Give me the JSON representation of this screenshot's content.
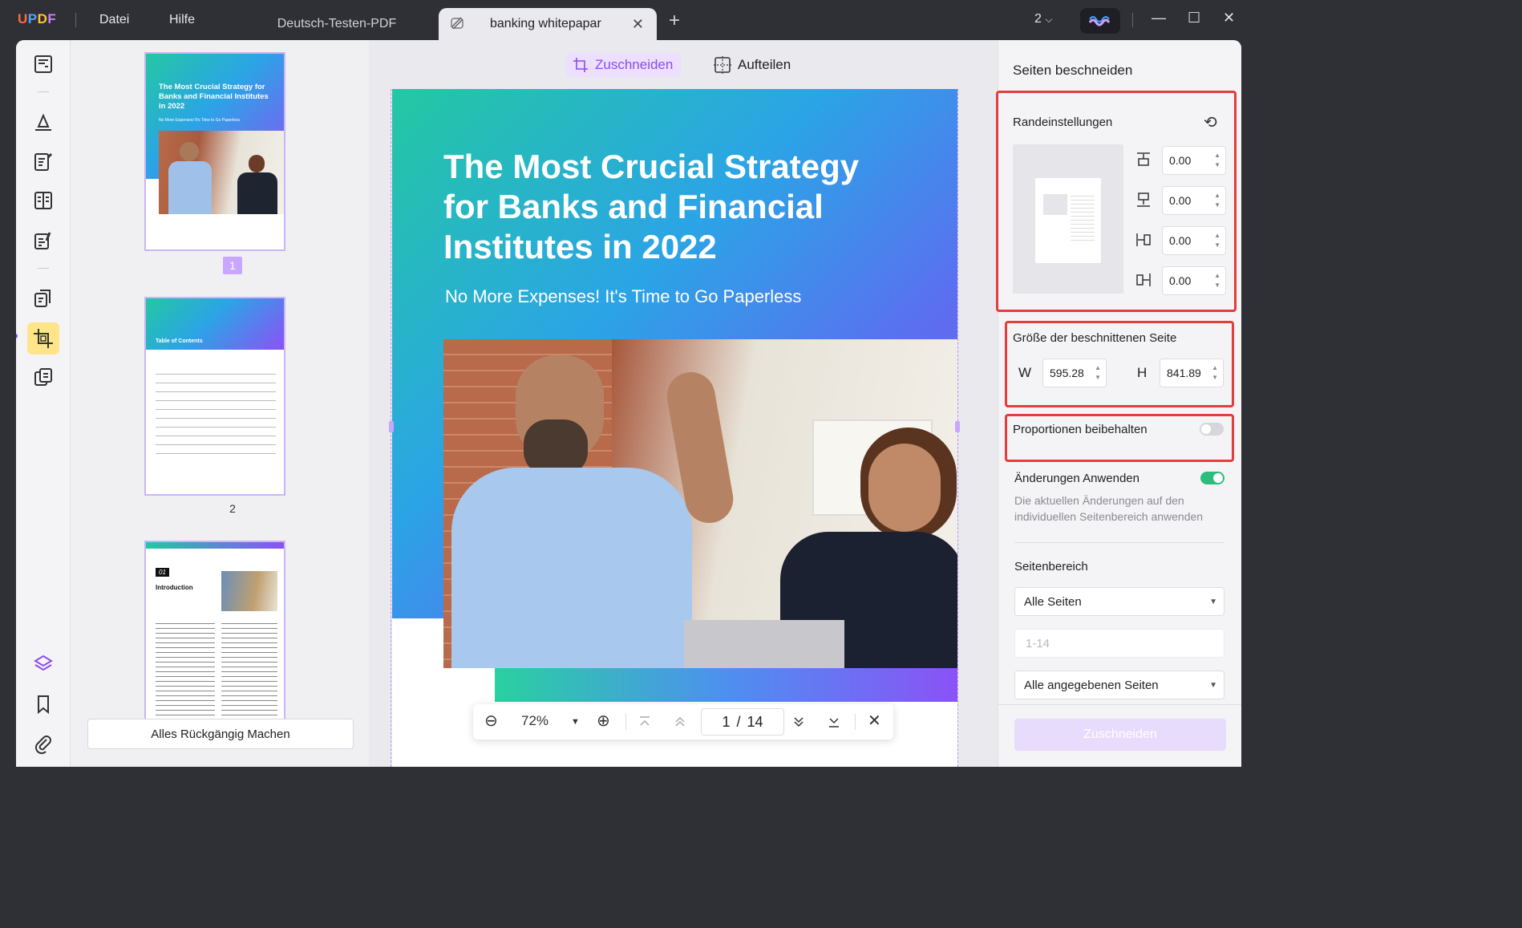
{
  "titlebar": {
    "logo": "UPDF",
    "menu": [
      "Datei",
      "Hilfe"
    ],
    "tabs": [
      {
        "label": "Deutsch-Testen-PDF",
        "active": false
      },
      {
        "label": "banking whitepapar",
        "active": true
      }
    ],
    "page_count": "2"
  },
  "thumbnails": {
    "pages": [
      {
        "number": "1",
        "selected": true,
        "title": "The Most Crucial Strategy for Banks and Financial Institutes in 2022",
        "subtitle": "No More Expenses! It's Time to Go Paperless"
      },
      {
        "number": "2",
        "selected": false,
        "title": "Table of Contents"
      },
      {
        "number": "3",
        "selected": false,
        "chapter": "01",
        "title": "Introduction"
      }
    ],
    "undo_label": "Alles Rückgängig Machen"
  },
  "toolbar": {
    "crop_label": "Zuschneiden",
    "split_label": "Aufteilen"
  },
  "document": {
    "title": "The Most Crucial Strategy for Banks and Financial Institutes in 2022",
    "subtitle": "No More Expenses! It's Time to Go Paperless"
  },
  "zoom": {
    "level": "72%",
    "current_page": "1",
    "separator": "/",
    "total_pages": "14"
  },
  "crop_panel": {
    "title": "Seiten beschneiden",
    "margins_label": "Randeinstellungen",
    "margins": {
      "top": "0.00",
      "bottom": "0.00",
      "left": "0.00",
      "right": "0.00"
    },
    "size_label": "Größe der beschnittenen Seite",
    "width_label": "W",
    "width": "595.28",
    "height_label": "H",
    "height": "841.89",
    "keep_ratio_label": "Proportionen beibehalten",
    "keep_ratio": false,
    "apply_changes_label": "Änderungen Anwenden",
    "apply_changes": true,
    "apply_changes_desc": "Die aktuellen Änderungen auf den individuellen Seitenbereich anwenden",
    "range_label": "Seitenbereich",
    "range_select": "Alle Seiten",
    "range_placeholder": "1-14",
    "subset_select": "Alle angegebenen Seiten",
    "crop_button": "Zuschneiden"
  },
  "colors": {
    "accent": "#8b4cf0",
    "highlight": "#e53c3c",
    "toggle_on": "#2bbd7e"
  }
}
